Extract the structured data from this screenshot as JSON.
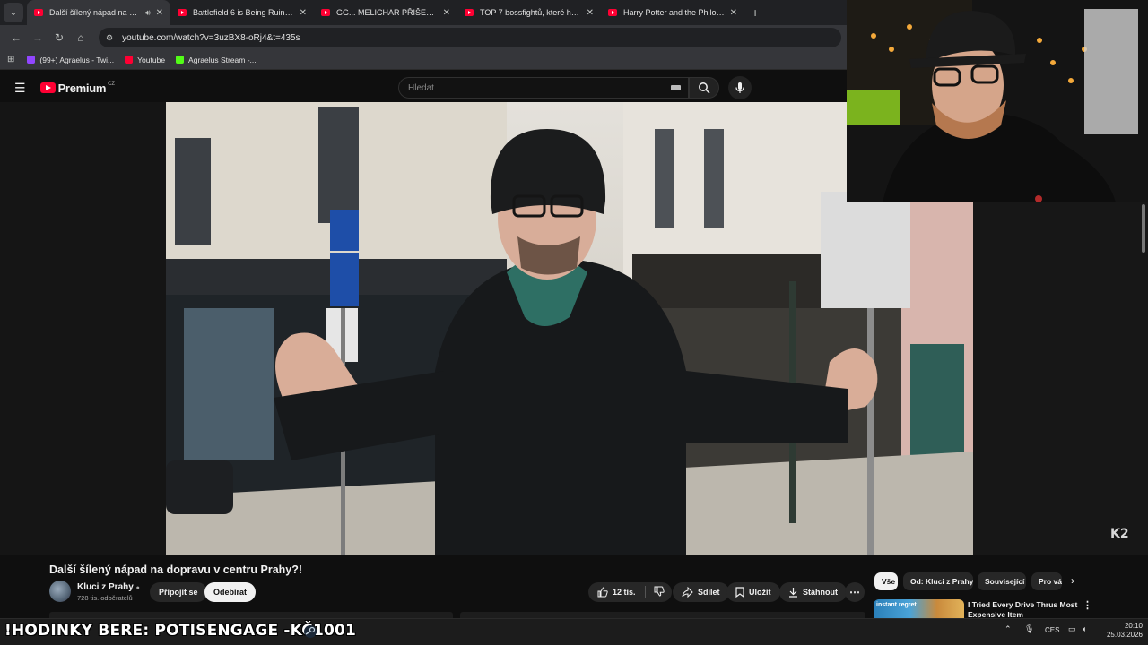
{
  "browser": {
    "tabs": [
      {
        "title": "Další šílený nápad na doprava",
        "active": true,
        "audio": true
      },
      {
        "title": "Battlefield 6 is Being Ruined By",
        "active": false
      },
      {
        "title": "GG... MELICHAR PŘIŠEL O DALŠÍ",
        "active": false
      },
      {
        "title": "TOP 7 bossfightů, které hraničí",
        "active": false
      },
      {
        "title": "Harry Potter and the Philosophe",
        "active": false
      }
    ],
    "url": "youtube.com/watch?v=3uzBX8-oRj4&t=435s",
    "bookmarks": [
      {
        "label": "(99+) Agraelus - Twi...",
        "color": "#9146ff"
      },
      {
        "label": "Youtube",
        "color": "#ff0033"
      },
      {
        "label": "Agraelus Stream -...",
        "color": "#53fc18"
      }
    ]
  },
  "youtube": {
    "logo_text": "Premium",
    "country_code": "CZ",
    "search_placeholder": "Hledat"
  },
  "video": {
    "title": "Další šílený nápad na dopravu v centru Prahy?!",
    "channel_name": "Kluci z Prahy",
    "subscribers": "728 tis. odběratelů",
    "join_label": "Připojit se",
    "subscribe_label": "Odebírat",
    "likes": "12 tis.",
    "share_label": "Sdílet",
    "save_label": "Uložit",
    "download_label": "Stáhnout",
    "watermark": "K2"
  },
  "chips": [
    "Vše",
    "Od: Kluci z Prahy",
    "Související",
    "Pro vás"
  ],
  "recommendation": {
    "thumb_label": "instant regret",
    "title": "I Tried Every Drive Thrus Most Expensive Item"
  },
  "overlay": {
    "ticker": "!HODINKY BERE: POTISENGAGE -KČ1001"
  },
  "taskbar": {
    "language": "CES",
    "time": "20:10",
    "date": "25.03.2026"
  },
  "colors": {
    "youtube_red": "#ff0033",
    "background": "#0f0f0f"
  }
}
